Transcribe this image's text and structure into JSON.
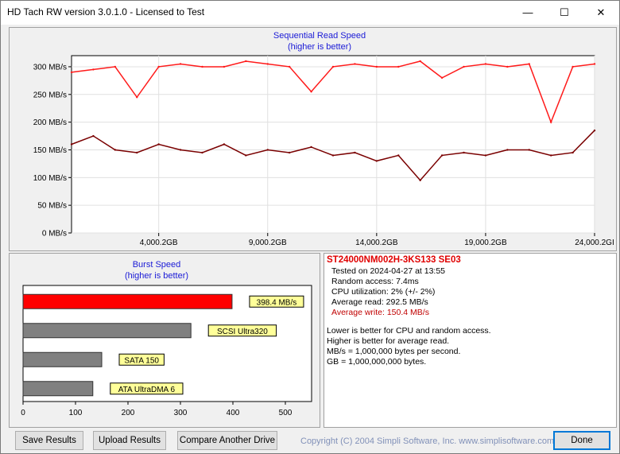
{
  "window": {
    "title": "HD Tach RW version 3.0.1.0 - Licensed to Test"
  },
  "seq_chart": {
    "title_line1": "Sequential Read Speed",
    "title_line2": "(higher is better)",
    "y_ticks": [
      "0 MB/s",
      "50 MB/s",
      "100 MB/s",
      "150 MB/s",
      "200 MB/s",
      "250 MB/s",
      "300 MB/s"
    ],
    "x_ticks": [
      "4,000.2GB",
      "9,000.2GB",
      "14,000.2GB",
      "19,000.2GB",
      "24,000.2GI"
    ]
  },
  "chart_data": [
    {
      "type": "line",
      "title": "Sequential Read Speed",
      "subtitle": "(higher is better)",
      "xlabel": "",
      "ylabel": "",
      "x": [
        0,
        1000,
        2000,
        3000,
        4000,
        5000,
        6000,
        7000,
        8000,
        9000,
        10000,
        11000,
        12000,
        13000,
        14000,
        15000,
        16000,
        17000,
        18000,
        19000,
        20000,
        21000,
        22000,
        23000,
        24000
      ],
      "ylim": [
        0,
        320
      ],
      "xlim": [
        0,
        24000
      ],
      "grid": true,
      "series": [
        {
          "color": "#ff1a1a",
          "values": [
            290,
            295,
            300,
            245,
            300,
            305,
            300,
            300,
            310,
            305,
            300,
            255,
            300,
            305,
            300,
            300,
            310,
            280,
            300,
            305,
            300,
            305,
            200,
            300,
            305
          ]
        },
        {
          "color": "#7a0000",
          "values": [
            160,
            175,
            150,
            145,
            160,
            150,
            145,
            160,
            140,
            150,
            145,
            155,
            140,
            145,
            130,
            140,
            95,
            140,
            145,
            140,
            150,
            150,
            140,
            145,
            185
          ]
        }
      ]
    },
    {
      "type": "bar",
      "title": "Burst Speed",
      "subtitle": "(higher is better)",
      "categories": [
        "398.4 MB/s",
        "SCSI Ultra320",
        "SATA 150",
        "ATA UltraDMA 6"
      ],
      "values": [
        398.4,
        320,
        150,
        133
      ],
      "colors": [
        "#ff0000",
        "#808080",
        "#808080",
        "#808080"
      ],
      "xlim": [
        0,
        550
      ],
      "xticks": [
        0,
        100,
        200,
        300,
        400,
        500
      ]
    }
  ],
  "burst_chart": {
    "title_line1": "Burst Speed",
    "title_line2": "(higher is better)",
    "bar_labels": [
      "398.4 MB/s",
      "SCSI Ultra320",
      "SATA 150",
      "ATA UltraDMA 6"
    ],
    "x_ticks": [
      "0",
      "100",
      "200",
      "300",
      "400",
      "500"
    ]
  },
  "info": {
    "drive_name": "ST24000NM002H-3KS133 SE03",
    "tested_on": "Tested on 2024-04-27 at 13:55",
    "random_access": "Random access: 7.4ms",
    "cpu": "CPU utilization: 2% (+/- 2%)",
    "avg_read": "Average read: 292.5 MB/s",
    "avg_write": "Average write: 150.4 MB/s",
    "note1": "Lower is better for CPU and random access.",
    "note2": "Higher is better for average read.",
    "note3": "MB/s = 1,000,000 bytes per second.",
    "note4": "GB = 1,000,000,000 bytes."
  },
  "buttons": {
    "save": "Save Results",
    "upload": "Upload Results",
    "compare": "Compare Another Drive",
    "done": "Done"
  },
  "footer": {
    "copyright": "Copyright (C) 2004 Simpli Software, Inc. www.simplisoftware.com"
  },
  "colors": {
    "read": "#ff1a1a",
    "write": "#7a0000",
    "accent_title": "#1a1ad6",
    "burst_primary": "#ff0000",
    "burst_ref": "#808080",
    "label_bg": "#ffff99"
  }
}
